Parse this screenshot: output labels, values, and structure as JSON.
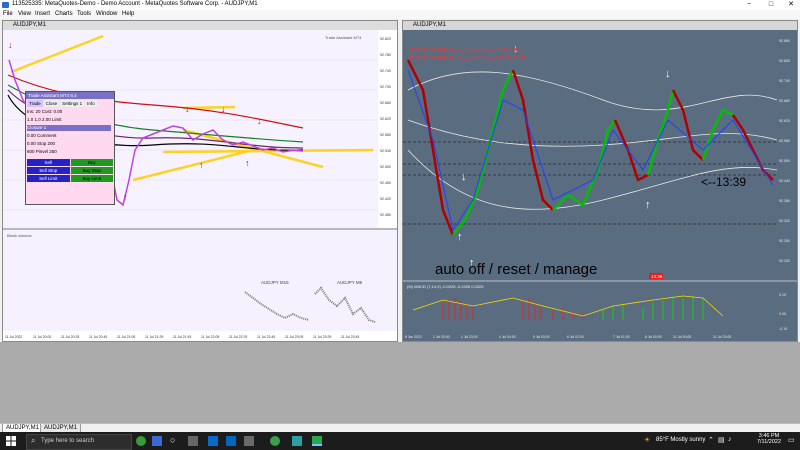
{
  "app": {
    "title": "113525335: MetaQuotes-Demo - Demo Account - MetaQuotes Software Corp. - AUDJPY,M1",
    "window_controls": [
      "−",
      "□",
      "✕"
    ]
  },
  "menu": [
    "File",
    "View",
    "Insert",
    "Charts",
    "Tools",
    "Window",
    "Help"
  ],
  "left_chart": {
    "title": "AUDJPY,M1",
    "indicator_label": "Trade Assistant MT4",
    "subwindow_label": "Blank window",
    "price_ticks": [
      "92.820",
      "92.780",
      "92.740",
      "92.700",
      "92.660",
      "92.620",
      "92.580",
      "92.540",
      "92.500",
      "92.460",
      "92.420",
      "92.380"
    ],
    "time_ticks": [
      "11 Jul 2022",
      "11 Jul 20:00",
      "11 Jul 20:25",
      "11 Jul 20:49",
      "11 Jul 21:09",
      "11 Jul 21:29",
      "11 Jul 21:49",
      "11 Jul 22:09",
      "11 Jul 22:29",
      "11 Jul 22:49",
      "11 Jul 23:09",
      "11 Jul 23:29",
      "11 Jul 23:49"
    ],
    "mini_charts": [
      "AUDJPY M15",
      "AUDJPY M5"
    ],
    "trade_panel": {
      "header": "Trade Assistant MT4 8.4",
      "buttons_row": [
        "Trade",
        "Close",
        "Settings 1",
        "Info"
      ],
      "rows": [
        "Ins: 20  Cost: 0.00",
        "1.0   1.0   2.00   Limit",
        "Closure 1",
        "0.00  Comment",
        "0.00   Stop   200",
        "600    Pinvel  250"
      ],
      "actions": [
        "Sell",
        "Buy",
        "Sell Stop",
        "Buy Stop",
        "Sell Limit",
        "Buy Limit"
      ]
    }
  },
  "right_chart": {
    "title": "AUDJPY,M1",
    "news": [
      "16:03:43:36  AUD: Unemployment Rate   3.9%    3.8%",
      "16:03:43:36  AUD: Employment Change   60.6K   30.0K"
    ],
    "annotation_time": "<--13:39",
    "caption": "auto off / reset / manage",
    "price_tag": "13:38",
    "macd_label": "(M) MACD (7,14,9)  -0.0228  -0.0326  0.0325",
    "price_ticks": [
      "92.860",
      "92.800",
      "92.740",
      "92.680",
      "92.620",
      "92.560",
      "92.500",
      "92.440",
      "92.380",
      "92.320",
      "92.260",
      "92.200"
    ],
    "macd_ticks": [
      "0.15",
      "0.00",
      "-0.15"
    ],
    "time_ticks": [
      "8 Jun 2022",
      "1 Jul 03:00",
      "1 Jul 23:00",
      "4 Jul 04:00",
      "5 Jul 03:00",
      "6 Jul 02:00",
      "7 Jul 01:00",
      "8 Jul 00:00",
      "11 Jul 00:00",
      "11 Jul 23:00"
    ],
    "colors": {
      "background": "#5a6c80",
      "bull": "#00c000",
      "bear": "#b00000",
      "accent": "#ffffff"
    }
  },
  "tabs": [
    "AUDJPY,M1",
    "AUDJPY,M1"
  ],
  "taskbar": {
    "search_placeholder": "Type here to search",
    "weather": "85°F  Mostly sunny",
    "time": "3:46 PM",
    "date": "7/11/2022"
  }
}
